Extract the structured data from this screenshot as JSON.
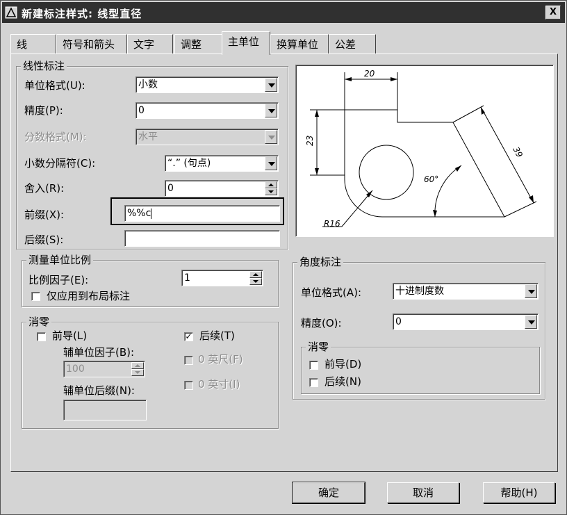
{
  "window": {
    "title": "新建标注样式: 线型直径",
    "close_label": "X"
  },
  "tabs": [
    {
      "label": "线"
    },
    {
      "label": "符号和箭头"
    },
    {
      "label": "文字"
    },
    {
      "label": "调整"
    },
    {
      "label": "主单位"
    },
    {
      "label": "换算单位"
    },
    {
      "label": "公差"
    }
  ],
  "linear": {
    "title": "线性标注",
    "unit_format_label": "单位格式(U):",
    "unit_format_value": "小数",
    "precision_label": "精度(P):",
    "precision_value": "0",
    "fraction_label": "分数格式(M):",
    "fraction_value": "水平",
    "decimal_sep_label": "小数分隔符(C):",
    "decimal_sep_value": "“.” (句点)",
    "round_label": "舍入(R):",
    "round_value": "0",
    "prefix_label": "前缀(X):",
    "prefix_value": "%%c",
    "suffix_label": "后缀(S):",
    "suffix_value": ""
  },
  "scale": {
    "title": "测量单位比例",
    "factor_label": "比例因子(E):",
    "factor_value": "1",
    "layout_only_label": "仅应用到布局标注",
    "layout_only_checked": false
  },
  "zero": {
    "title": "消零",
    "leading_label": "前导(L)",
    "leading_checked": false,
    "trailing_label": "后续(T)",
    "trailing_checked": true,
    "sub_factor_label": "辅单位因子(B):",
    "sub_factor_value": "100",
    "sub_suffix_label": "辅单位后缀(N):",
    "sub_suffix_value": "",
    "feet_label": "0 英尺(F)",
    "inches_label": "0 英寸(I)"
  },
  "angular": {
    "title": "角度标注",
    "unit_format_label": "单位格式(A):",
    "unit_format_value": "十进制度数",
    "precision_label": "精度(O):",
    "precision_value": "0",
    "zero_title": "消零",
    "leading_label": "前导(D)",
    "trailing_label": "后续(N)"
  },
  "preview": {
    "dim_top": "20",
    "dim_left": "23",
    "dim_slant": "39",
    "angle": "60°",
    "radius": "R16"
  },
  "buttons": {
    "ok": "确定",
    "cancel": "取消",
    "help": "帮助(H)"
  }
}
